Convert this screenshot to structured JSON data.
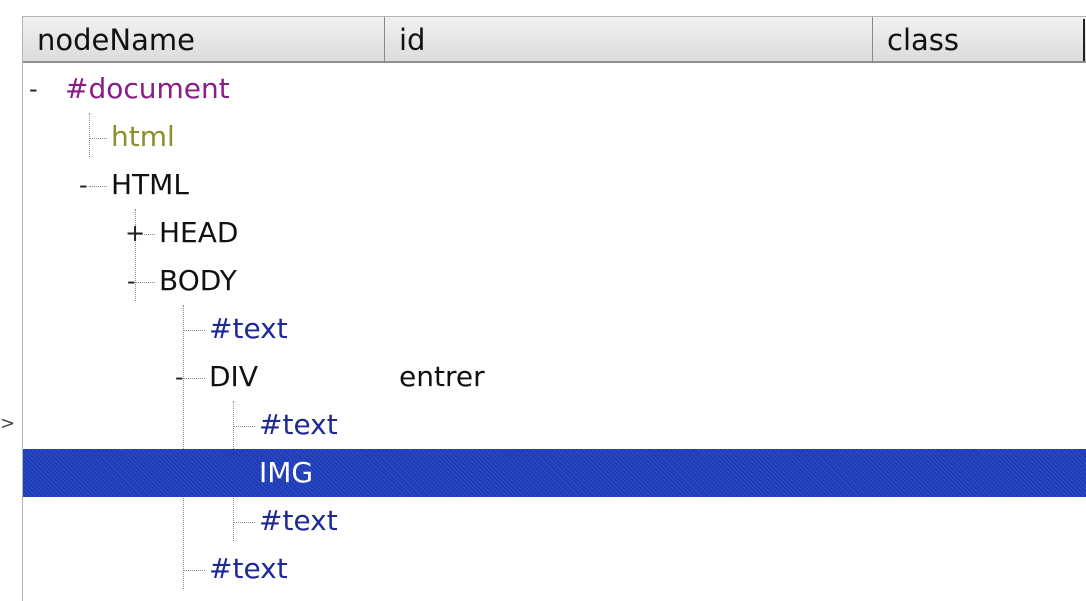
{
  "columns": {
    "nodename": "nodeName",
    "id": "id",
    "class": "class"
  },
  "tree": {
    "document": {
      "toggle": "-",
      "label": "#document"
    },
    "html_doctype": {
      "label": "html"
    },
    "html": {
      "toggle": "-",
      "label": "HTML"
    },
    "head": {
      "toggle": "+",
      "label": "HEAD"
    },
    "body": {
      "toggle": "-",
      "label": "BODY"
    },
    "text1": {
      "label": "#text"
    },
    "div": {
      "toggle": "-",
      "label": "DIV",
      "id": "entrer"
    },
    "text2": {
      "label": "#text"
    },
    "img": {
      "label": "IMG"
    },
    "text3": {
      "label": "#text"
    },
    "text4": {
      "label": "#text"
    }
  },
  "pointer_glyph": ">",
  "colors": {
    "selection": "#1c3bb8",
    "document_node": "#8a1d87",
    "doctype_node": "#8c8f2c",
    "text_node": "#1f2a96"
  }
}
